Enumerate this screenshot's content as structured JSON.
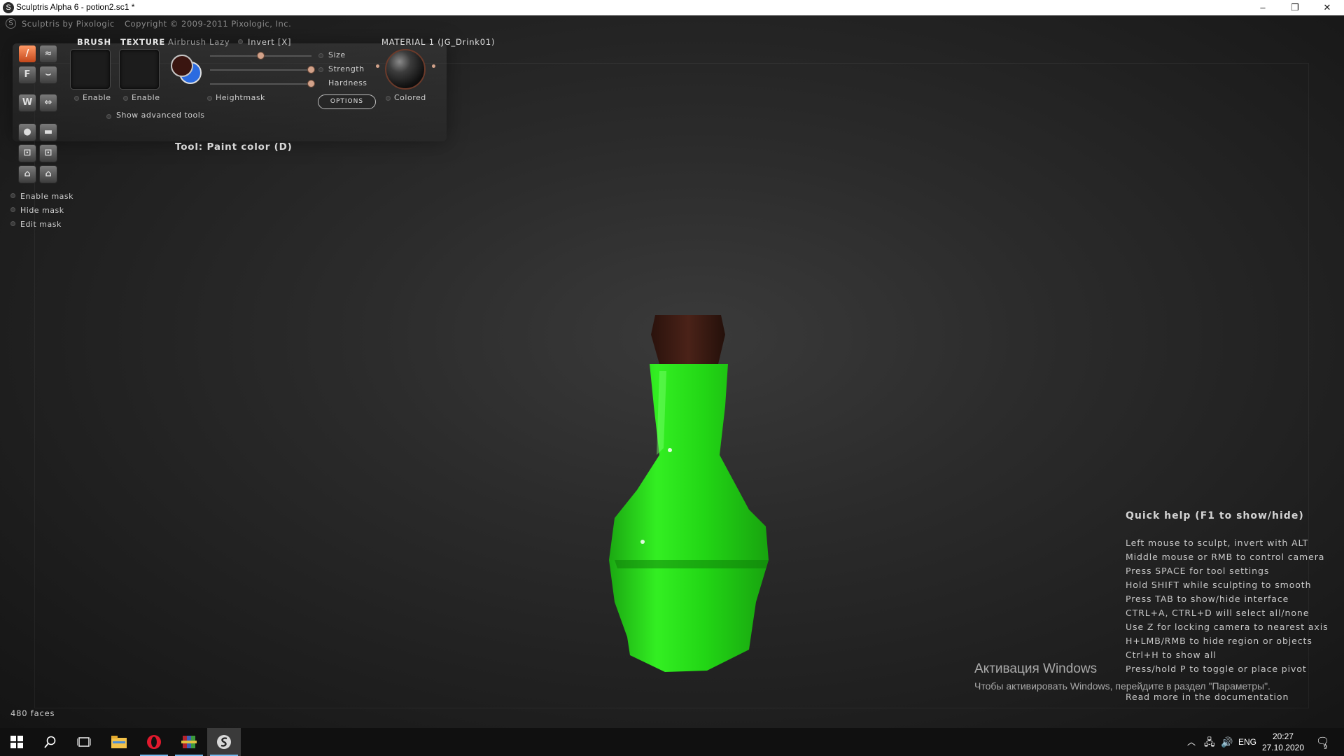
{
  "window": {
    "title": "Sculptris Alpha 6 - potion2.sc1 *",
    "controls": {
      "minimize": "–",
      "restore": "❐",
      "close": "✕"
    }
  },
  "brand": {
    "name": "Sculptris by Pixologic",
    "copyright": "Copyright © 2009-2011 Pixologic, Inc."
  },
  "panel": {
    "brush_header": "BRUSH",
    "texture_header": "TEXTURE",
    "airbrush": "Airbrush",
    "lazy": "Lazy",
    "invert": "Invert [X]",
    "brush_enable": "Enable",
    "texture_enable": "Enable",
    "size": "Size",
    "strength": "Strength",
    "hardness": "Hardness",
    "heightmask": "Heightmask",
    "options": "OPTIONS",
    "material_header": "MATERIAL 1 (JG_Drink01)",
    "colored": "Colored",
    "show_advanced": "Show advanced tools",
    "sliders": {
      "size": 0.5,
      "strength": 1.0,
      "hardness": 1.0
    },
    "primary_color": "#3a1510",
    "secondary_color": "#2b6be0"
  },
  "tool_label": "Tool: Paint color (D)",
  "mask": {
    "enable": "Enable mask",
    "hide": "Hide mask",
    "edit": "Edit mask"
  },
  "help": {
    "title": "Quick help (F1 to show/hide)",
    "lines": [
      "Left mouse to sculpt, invert with ALT",
      "Middle mouse or RMB to control camera",
      "Press SPACE for tool settings",
      "Hold SHIFT while sculpting to smooth",
      "Press TAB to show/hide interface",
      "CTRL+A, CTRL+D will select all/none",
      "Use Z for locking camera to nearest axis",
      "H+LMB/RMB to hide region or objects",
      "Ctrl+H to show all",
      "Press/hold P to toggle or place pivot",
      "Read more in the documentation"
    ]
  },
  "activation": {
    "title": "Активация Windows",
    "subtitle": "Чтобы активировать Windows, перейдите в раздел \"Параметры\"."
  },
  "status": {
    "faces": "480 faces"
  },
  "taskbar": {
    "language": "ENG",
    "time": "20:27",
    "date": "27.10.2020",
    "notifications": "9"
  },
  "colors": {
    "potion_green": "#22e01a",
    "cork": "#3b1a12",
    "accent": "#d2a28a"
  }
}
